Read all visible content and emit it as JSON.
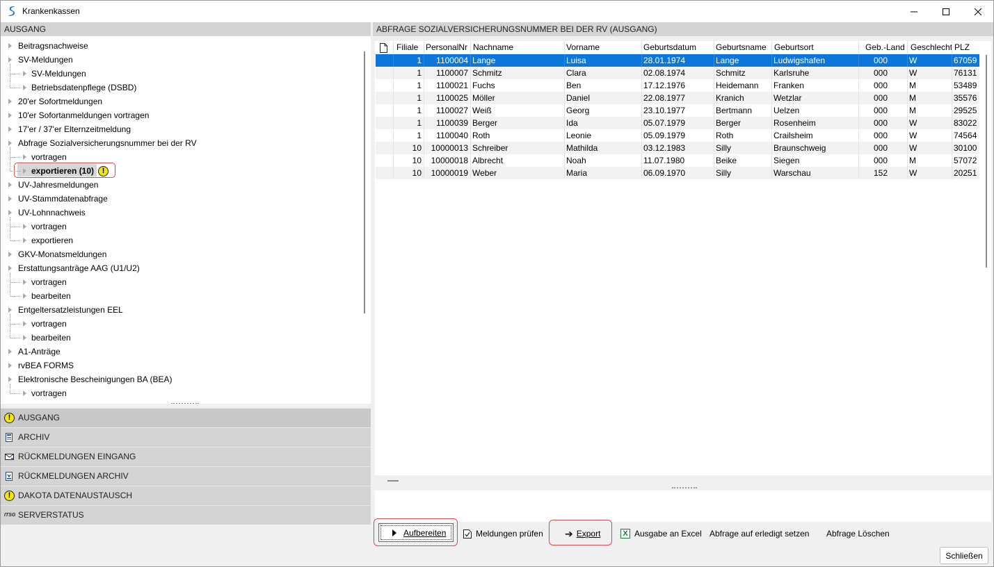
{
  "window": {
    "title": "Krankenkassen",
    "minimize_glyph": "—",
    "maximize_glyph": "☐",
    "close_glyph": "✕"
  },
  "left_panel": {
    "header": "AUSGANG",
    "tree": [
      {
        "label": "Beitragsnachweise",
        "level": 0
      },
      {
        "label": "SV-Meldungen",
        "level": 0
      },
      {
        "label": "SV-Meldungen",
        "level": 1
      },
      {
        "label": "Betriebsdatenpflege (DSBD)",
        "level": 1
      },
      {
        "label": "20'er Sofortmeldungen",
        "level": 0
      },
      {
        "label": "10'er Sofortanmeldungen vortragen",
        "level": 0
      },
      {
        "label": "17'er / 37'er Elternzeitmeldung",
        "level": 0
      },
      {
        "label": "Abfrage Sozialversicherungsnummer bei der RV",
        "level": 0
      },
      {
        "label": "vortragen",
        "level": 1
      },
      {
        "label": "exportieren (10)",
        "level": 1,
        "selected": true,
        "warning": true
      },
      {
        "label": "UV-Jahresmeldungen",
        "level": 0
      },
      {
        "label": "UV-Stammdatenabfrage",
        "level": 0
      },
      {
        "label": "UV-Lohnnachweis",
        "level": 0
      },
      {
        "label": "vortragen",
        "level": 1
      },
      {
        "label": "exportieren",
        "level": 1
      },
      {
        "label": "GKV-Monatsmeldungen",
        "level": 0
      },
      {
        "label": "Erstattungsanträge AAG (U1/U2)",
        "level": 0
      },
      {
        "label": "vortragen",
        "level": 1
      },
      {
        "label": "bearbeiten",
        "level": 1
      },
      {
        "label": "Entgeltersatzleistungen EEL",
        "level": 0
      },
      {
        "label": "vortragen",
        "level": 1
      },
      {
        "label": "bearbeiten",
        "level": 1
      },
      {
        "label": "A1-Anträge",
        "level": 0
      },
      {
        "label": "rvBEA FORMS",
        "level": 0
      },
      {
        "label": "Elektronische Bescheinigungen BA (BEA)",
        "level": 0
      },
      {
        "label": "vortragen",
        "level": 1
      }
    ],
    "warning_glyph": "!",
    "nav": [
      {
        "label": "AUSGANG",
        "icon": "warning-icon",
        "active": true
      },
      {
        "label": "ARCHIV",
        "icon": "archive-icon"
      },
      {
        "label": "RÜCKMELDUNGEN EINGANG",
        "icon": "mail-inbox-icon"
      },
      {
        "label": "RÜCKMELDUNGEN ARCHIV",
        "icon": "mail-archive-icon"
      },
      {
        "label": "DAKOTA DATENAUSTAUSCH",
        "icon": "warning-icon"
      },
      {
        "label": "SERVERSTATUS",
        "icon": "itsg-server-icon"
      }
    ],
    "itsg_text": "ITSG"
  },
  "right_panel": {
    "header": "ABFRAGE SOZIALVERSICHERUNGSNUMMER BEI DER RV (AUSGANG)",
    "columns": [
      "Filiale",
      "PersonalNr",
      "Nachname",
      "Vorname",
      "Geburtsdatum",
      "Geburtsname",
      "Geburtsort",
      "Geb.-Land",
      "Geschlecht",
      "PLZ"
    ],
    "rows": [
      [
        "1",
        "1100004",
        "Lange",
        "Luisa",
        "28.01.1974",
        "Lange",
        "Ludwigshafen",
        "000",
        "W",
        "67059"
      ],
      [
        "1",
        "1100007",
        "Schmitz",
        "Clara",
        "02.08.1974",
        "Schmitz",
        "Karlsruhe",
        "000",
        "W",
        "76131"
      ],
      [
        "1",
        "1100021",
        "Fuchs",
        "Ben",
        "17.12.1976",
        "Heidemann",
        "Franken",
        "000",
        "M",
        "53489"
      ],
      [
        "1",
        "1100025",
        "Möller",
        "Daniel",
        "22.08.1977",
        "Kranich",
        "Wetzlar",
        "000",
        "M",
        "35576"
      ],
      [
        "1",
        "1100027",
        "Weiß",
        "Georg",
        "23.10.1977",
        "Bertmann",
        "Uelzen",
        "000",
        "M",
        "29525"
      ],
      [
        "1",
        "1100039",
        "Berger",
        "Ida",
        "05.07.1979",
        "Berger",
        "Rosenheim",
        "000",
        "W",
        "83022"
      ],
      [
        "1",
        "1100040",
        "Roth",
        "Leonie",
        "05.09.1979",
        "Roth",
        "Crailsheim",
        "000",
        "W",
        "74564"
      ],
      [
        "10",
        "10000013",
        "Schreiber",
        "Mathilda",
        "03.12.1983",
        "Silly",
        "Braunschweig",
        "000",
        "W",
        "30100"
      ],
      [
        "10",
        "10000018",
        "Albrecht",
        "Noah",
        "11.07.1980",
        "Beike",
        "Siegen",
        "000",
        "M",
        "57072"
      ],
      [
        "10",
        "10000019",
        "Weber",
        "Maria",
        "06.09.1970",
        "Silly",
        "Warschau",
        "152",
        "W",
        "20251"
      ]
    ],
    "selected_row": 0
  },
  "toolbar": {
    "aufbereiten_label": "Aufbereiten",
    "meldungen_pruefen_label": "Meldungen prüfen",
    "export_label": "Export",
    "excel_label": "Ausgabe an Excel",
    "erledigt_label": "Abfrage auf erledigt setzen",
    "loeschen_label": "Abfrage Löschen",
    "excel_icon_letter": "X",
    "export_arrow": "➔"
  },
  "footer": {
    "close_label": "Schließen"
  },
  "colors": {
    "selection": "#0c77d8",
    "highlight_border": "#e0474c",
    "warning_fill": "#f1e515"
  }
}
